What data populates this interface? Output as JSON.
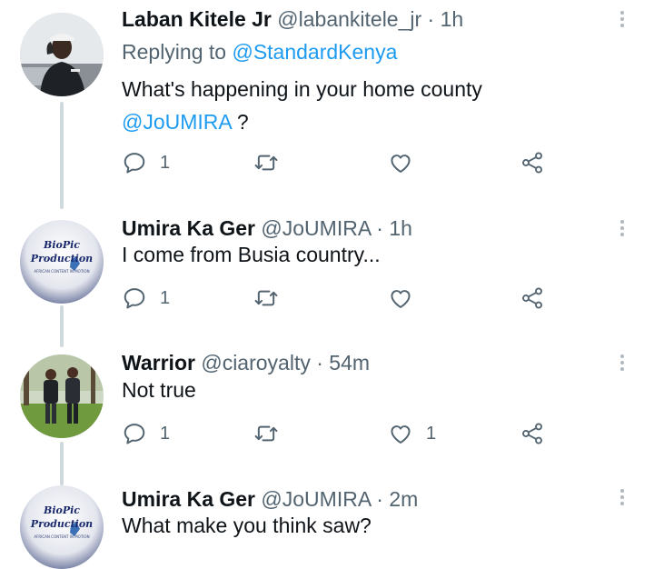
{
  "tweets": [
    {
      "name": "Laban Kitele Jr",
      "handle": "@labankitele_jr",
      "time": "1h",
      "replying_prefix": "Replying to",
      "replying_handle": "@StandardKenya",
      "text_line1": "What's happening in your home county",
      "text_mention": "@JoUMIRA",
      "text_suffix": " ?",
      "reply_count": "1",
      "like_count": ""
    },
    {
      "name": "Umira Ka Ger",
      "handle": "@JoUMIRA",
      "time": "1h",
      "text": "I come from Busia country...",
      "avatar_title": "BioPic",
      "avatar_subtitle": "Production",
      "avatar_tagline": "AFRICAN CONTENT IN MOTION",
      "reply_count": "1",
      "like_count": ""
    },
    {
      "name": "Warrior",
      "handle": "@ciaroyalty",
      "time": "54m",
      "text": "Not true",
      "reply_count": "1",
      "like_count": "1"
    },
    {
      "name": "Umira Ka Ger",
      "handle": "@JoUMIRA",
      "time": "2m",
      "text": "What make you think saw?",
      "avatar_title": "BioPic",
      "avatar_subtitle": "Production",
      "avatar_tagline": "AFRICAN CONTENT IN MOTION"
    }
  ],
  "separator": " · ",
  "icons": {
    "reply": "reply-icon",
    "retweet": "retweet-icon",
    "like": "like-icon",
    "share": "share-icon",
    "more": "more-icon"
  },
  "colors": {
    "link": "#1d9bf0",
    "muted": "#536471",
    "icon": "#536471",
    "thread_line": "#cfd9de"
  }
}
